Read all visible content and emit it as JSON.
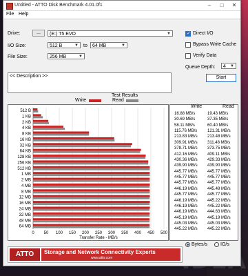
{
  "window": {
    "title": "Untitled - ATTO Disk Benchmark 4.01.0f1",
    "min": "–",
    "max": "□",
    "close": "✕"
  },
  "menu": {
    "file": "File",
    "help": "Help"
  },
  "drive": {
    "label": "Drive:",
    "browse": "...",
    "value": "(E:) T5 EVO"
  },
  "io_size": {
    "label": "I/O Size:",
    "from": "512 B",
    "to_label": "to",
    "to": "64 MB"
  },
  "file_size": {
    "label": "File Size:",
    "value": "256 MB"
  },
  "options": {
    "direct_io": "Direct I/O",
    "direct_io_checked": true,
    "bypass_write_cache": "Bypass Write Cache",
    "bypass_checked": false,
    "verify_data": "Verify Data",
    "verify_checked": false
  },
  "queue_depth": {
    "label": "Queue Depth:",
    "value": "4"
  },
  "start_button": "Start",
  "description": "<< Description >>",
  "results_header": {
    "title": "Test Results",
    "write": "Write",
    "read": "Read"
  },
  "legend": {
    "write": "Write",
    "read": "Read",
    "write_color": "#cc2222",
    "read_color": "#888888"
  },
  "chart_data": {
    "type": "bar",
    "orientation": "horizontal",
    "xlabel": "Transfer Rate - MB/s",
    "xlim": [
      0,
      500
    ],
    "xticks": [
      "0",
      "50",
      "100",
      "150",
      "200",
      "250",
      "300",
      "350",
      "400",
      "450",
      "500"
    ],
    "categories": [
      "512 B",
      "1 KB",
      "2 KB",
      "4 KB",
      "8 KB",
      "16 KB",
      "32 KB",
      "64 KB",
      "128 KB",
      "256 KB",
      "512 KB",
      "1 MB",
      "2 MB",
      "4 MB",
      "8 MB",
      "12 MB",
      "16 MB",
      "24 MB",
      "32 MB",
      "48 MB",
      "64 MB"
    ],
    "series": [
      {
        "name": "Write",
        "values": [
          16.88,
          30.69,
          58.11,
          115.76,
          213.83,
          309.91,
          378.71,
          412.16,
          430.36,
          439.9,
          445.77,
          445.77,
          445.77,
          446.19,
          445.77,
          446.19,
          446.19,
          446.19,
          445.19,
          445.03,
          445.22
        ]
      },
      {
        "name": "Read",
        "values": [
          19.43,
          37.35,
          60.4,
          121.31,
          213.48,
          311.48,
          373.75,
          409.11,
          429.33,
          439.9,
          445.77,
          445.77,
          445.77,
          445.48,
          445.77,
          445.22,
          445.22,
          444.63,
          445.19,
          445.03,
          445.22
        ]
      }
    ]
  },
  "results": {
    "write": [
      "16.88 MB/s",
      "30.69 MB/s",
      "58.11 MB/s",
      "115.76 MB/s",
      "213.83 MB/s",
      "309.91 MB/s",
      "378.71 MB/s",
      "412.16 MB/s",
      "430.36 MB/s",
      "439.90 MB/s",
      "445.77 MB/s",
      "445.77 MB/s",
      "445.77 MB/s",
      "446.19 MB/s",
      "445.77 MB/s",
      "446.19 MB/s",
      "446.19 MB/s",
      "446.19 MB/s",
      "445.19 MB/s",
      "445.03 MB/s",
      "445.22 MB/s"
    ],
    "read": [
      "19.43 MB/s",
      "37.35 MB/s",
      "60.40 MB/s",
      "121.31 MB/s",
      "213.48 MB/s",
      "311.48 MB/s",
      "373.75 MB/s",
      "409.11 MB/s",
      "429.33 MB/s",
      "439.90 MB/s",
      "445.77 MB/s",
      "445.77 MB/s",
      "445.77 MB/s",
      "445.48 MB/s",
      "445.77 MB/s",
      "445.22 MB/s",
      "445.22 MB/s",
      "444.63 MB/s",
      "445.19 MB/s",
      "445.03 MB/s",
      "445.22 MB/s"
    ]
  },
  "units": {
    "bytes": "Bytes/s",
    "ios": "IO/s",
    "bytes_selected": true
  },
  "banner": {
    "logo": "ATTO",
    "tagline": "Storage and Network Connectivity Experts",
    "url": "www.atto.com"
  },
  "background_text": "IDEA"
}
